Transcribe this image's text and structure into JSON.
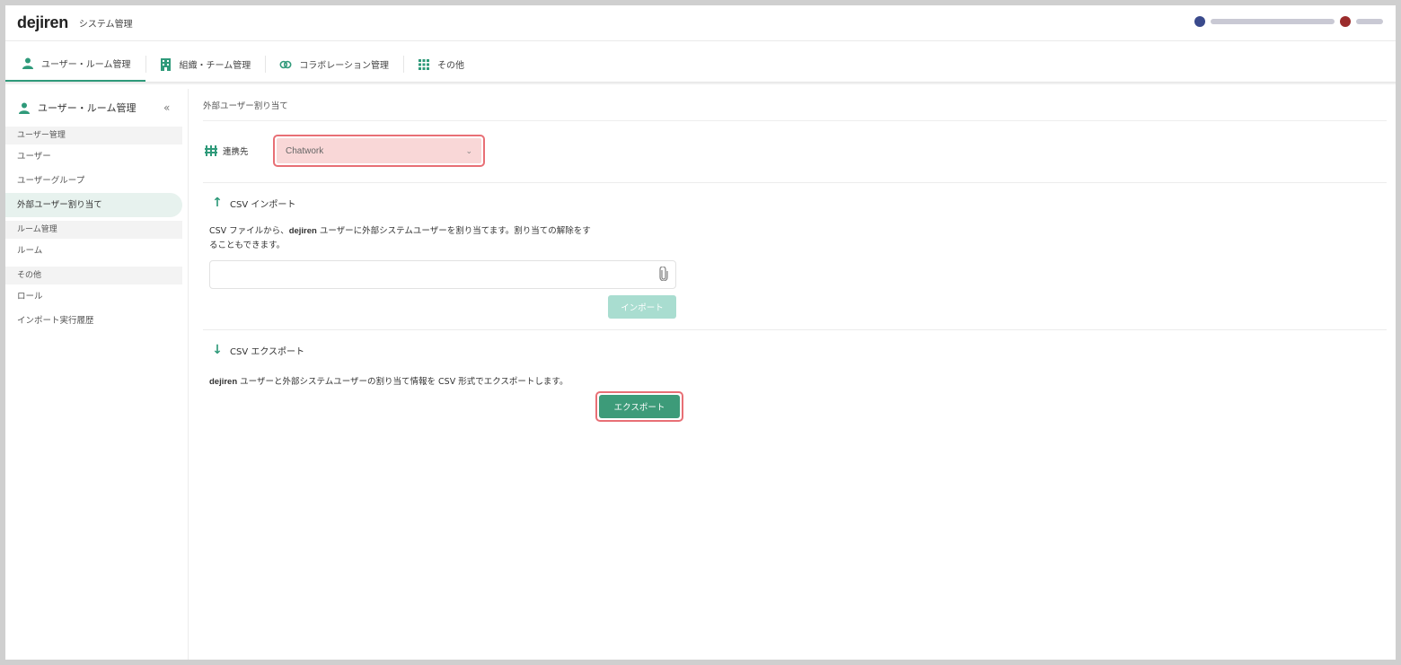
{
  "header": {
    "logo": "dejiren",
    "subtitle": "システム管理"
  },
  "tabs": [
    {
      "label": "ユーザー・ルーム管理",
      "icon": "user-icon"
    },
    {
      "label": "組織・チーム管理",
      "icon": "building-icon"
    },
    {
      "label": "コラボレーション管理",
      "icon": "link-icon"
    },
    {
      "label": "その他",
      "icon": "grid-icon"
    }
  ],
  "sidebar": {
    "title": "ユーザー・ルーム管理",
    "collapse": "«",
    "sections": [
      {
        "header": "ユーザー管理",
        "items": [
          "ユーザー",
          "ユーザーグループ",
          "外部ユーザー割り当て"
        ]
      },
      {
        "header": "ルーム管理",
        "items": [
          "ルーム"
        ]
      },
      {
        "header": "その他",
        "items": [
          "ロール",
          "インポート実行履歴"
        ]
      }
    ],
    "active_item": "外部ユーザー割り当て"
  },
  "main": {
    "breadcrumb": "外部ユーザー割り当て",
    "link_label": "連携先",
    "link_value": "Chatwork",
    "import": {
      "title": "CSV インポート",
      "desc_line1_pre": "CSV ファイルから、",
      "desc_brand": "dejiren",
      "desc_line1_post": " ユーザーに外部システムユーザーを割り当てます。割り当ての解除をす",
      "desc_line2": "ることもできます。",
      "button": "インポート"
    },
    "export": {
      "title": "CSV エクスポート",
      "desc_brand": "dejiren",
      "desc_post": " ユーザーと外部システムユーザーの割り当て情報を CSV 形式でエクスポートします。",
      "button": "エクスポート"
    }
  },
  "colors": {
    "accent": "#2f9a7a",
    "highlight": "#e86f75",
    "select_bg": "#f9d7d7"
  }
}
